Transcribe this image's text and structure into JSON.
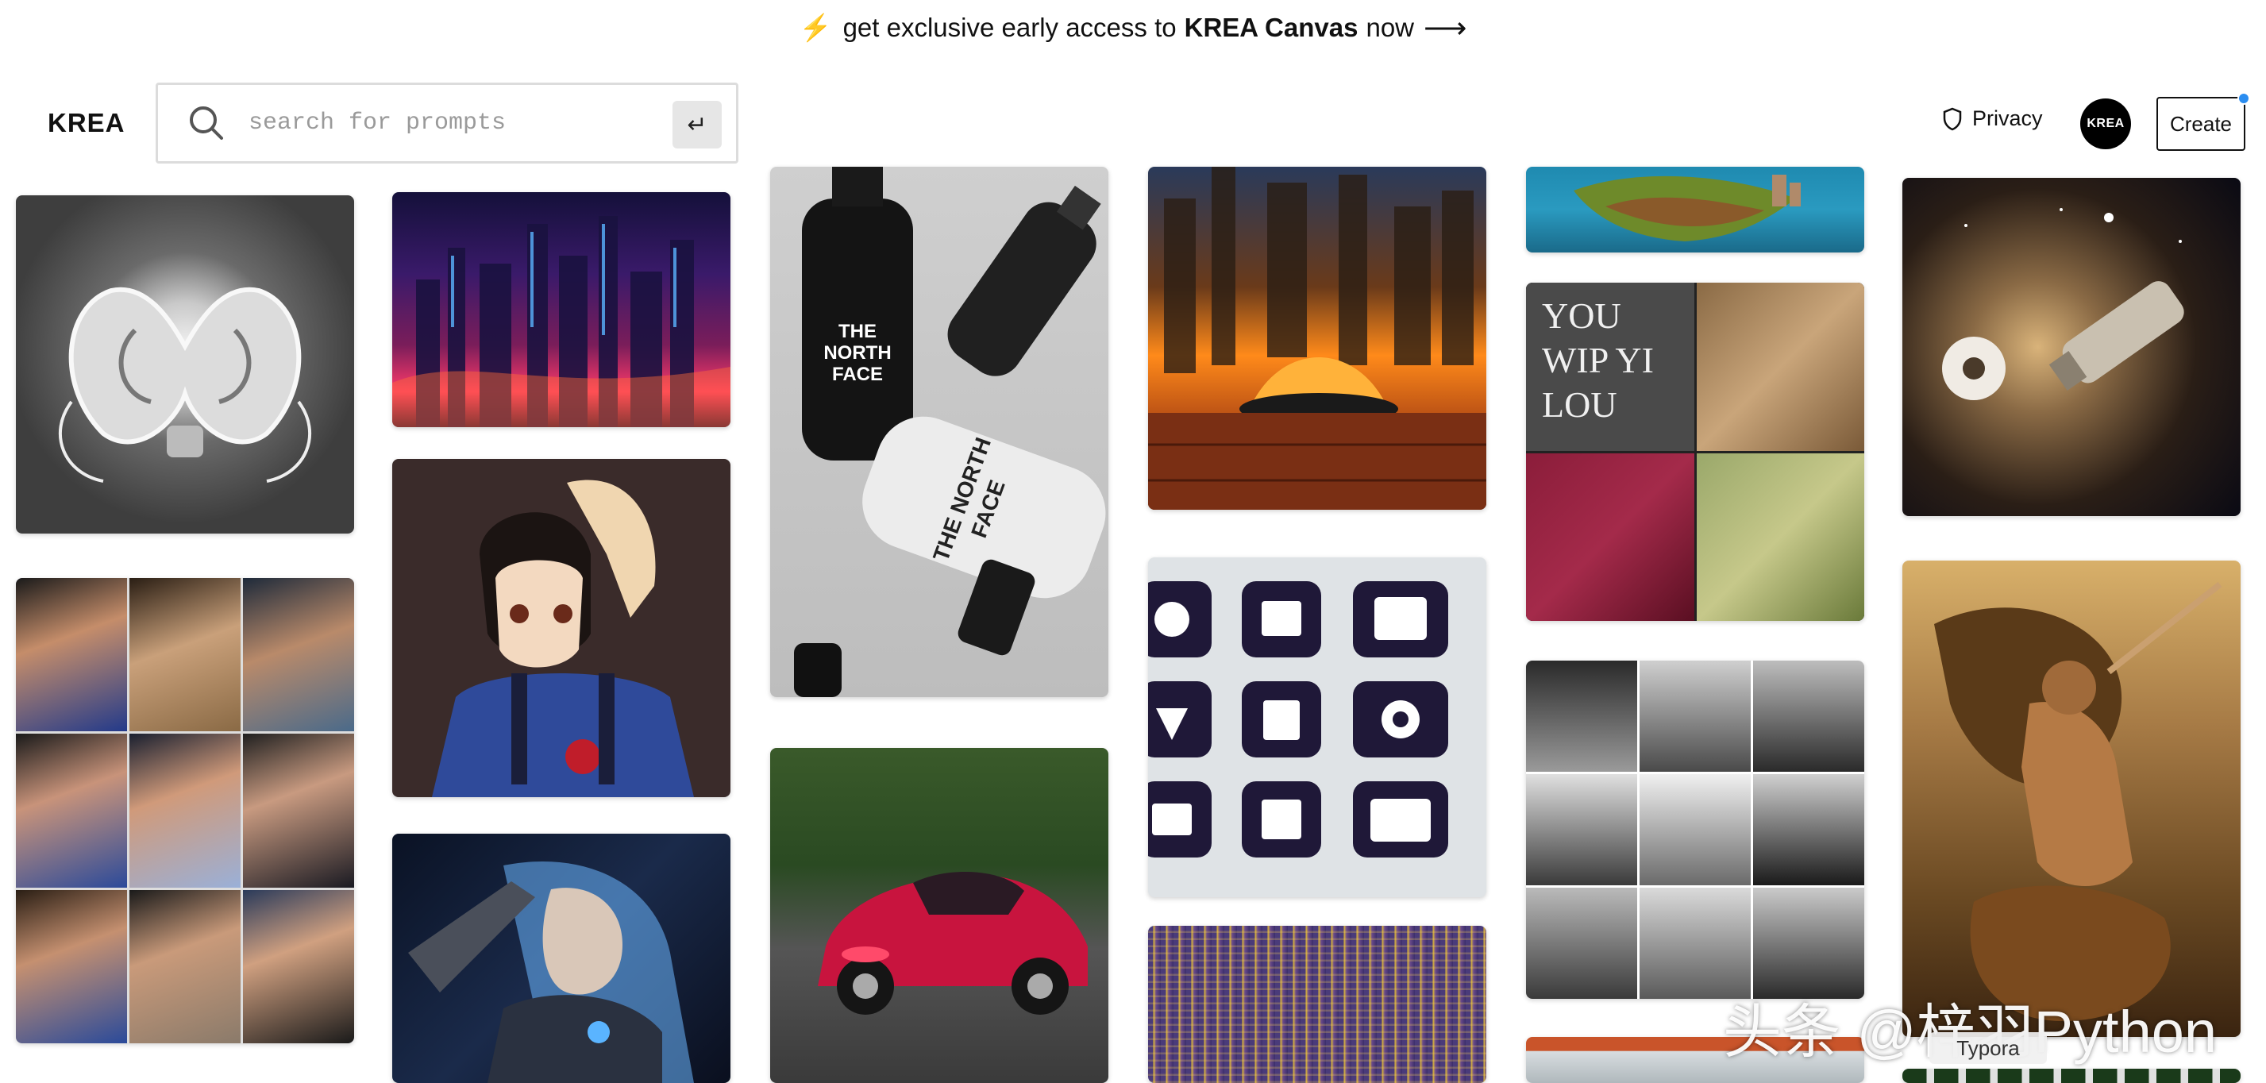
{
  "banner": {
    "prefix": "get exclusive early access to",
    "product": "KREA Canvas",
    "suffix": "now"
  },
  "header": {
    "logo": "KREA",
    "search": {
      "placeholder": "search for prompts",
      "value": ""
    },
    "privacy_label": "Privacy",
    "avatar_text": "KREA",
    "create_label": "Create"
  },
  "gallery": {
    "images": [
      {
        "name": "chrome-lobster-sculpture",
        "palette": [
          "#5a5a5a",
          "#d8d8d8"
        ]
      },
      {
        "name": "neon-night-cityscape",
        "palette": [
          "#1d1440",
          "#ff4a7a"
        ]
      },
      {
        "name": "north-face-bottles-mockup",
        "palette": [
          "#cfcfcf",
          "#1a1a1a"
        ],
        "text": "THE NORTH FACE"
      },
      {
        "name": "burning-city-table",
        "palette": [
          "#3b1d0c",
          "#ff8a1a"
        ]
      },
      {
        "name": "floating-island",
        "palette": [
          "#1b7da0",
          "#6e8a2a"
        ]
      },
      {
        "name": "space-ship-nebula",
        "palette": [
          "#2a1e16",
          "#d9b37a"
        ]
      },
      {
        "name": "anime-girl-overalls",
        "palette": [
          "#3a2b2a",
          "#2f4a9a"
        ]
      },
      {
        "name": "typography-cat-collage",
        "palette": [
          "#4a4a4a",
          "#8b1d3a"
        ],
        "text": "YOU WIP YI LOU"
      },
      {
        "name": "woman-portrait-grid",
        "palette": [
          "#2a3f7a",
          "#c79a70"
        ]
      },
      {
        "name": "app-icon-set",
        "palette": [
          "#dfe3e6",
          "#1f1838"
        ]
      },
      {
        "name": "office-photos-grid",
        "palette": [
          "#e6e6e6",
          "#202020"
        ]
      },
      {
        "name": "barbarian-dragon-painting",
        "palette": [
          "#6b4a23",
          "#b8844b"
        ]
      },
      {
        "name": "cyber-girl-blue-hair",
        "palette": [
          "#1a2a4a",
          "#6cb6ff"
        ]
      },
      {
        "name": "red-sports-car",
        "palette": [
          "#2a4a22",
          "#d81d46"
        ]
      },
      {
        "name": "purple-gold-city",
        "palette": [
          "#4a3b7a",
          "#d9b43a"
        ]
      },
      {
        "name": "fuzzy-texture",
        "palette": [
          "#c9542a",
          "#d8dde0"
        ]
      }
    ]
  },
  "overlay": {
    "watermark": "头条 @梓羽Python",
    "tooltip": "Typora"
  }
}
